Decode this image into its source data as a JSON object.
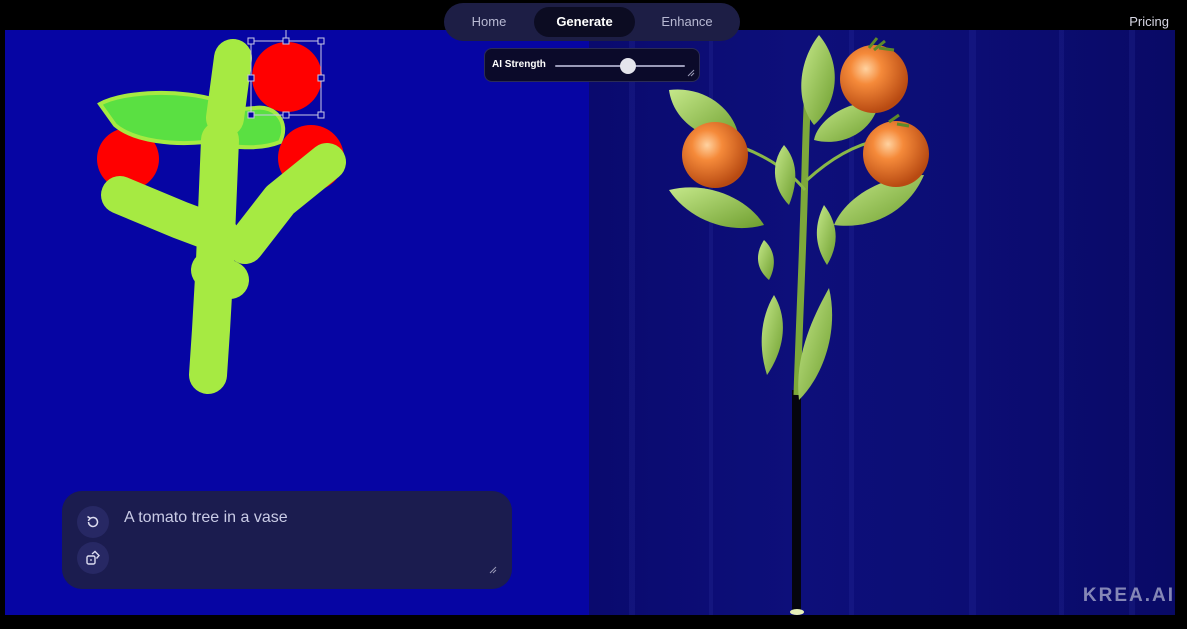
{
  "nav": {
    "tabs": [
      {
        "label": "Home"
      },
      {
        "label": "Generate"
      },
      {
        "label": "Enhance"
      }
    ],
    "active_tab": "Generate",
    "pricing_label": "Pricing"
  },
  "ai_strength": {
    "label": "AI Strength",
    "value": 0.56
  },
  "prompt": {
    "text": "A tomato tree in a vase"
  },
  "watermark": "KREA.AI",
  "icons": {
    "refresh": "rotate-icon",
    "dice": "dice-icon"
  },
  "colors": {
    "canvas_background": "#0605a3",
    "stem_green": "#a6ea42",
    "leaf_green": "#5ae042",
    "tomato_red": "#ff0000",
    "nav_background": "#1d1e45",
    "prompt_background": "#1b1c4f"
  }
}
